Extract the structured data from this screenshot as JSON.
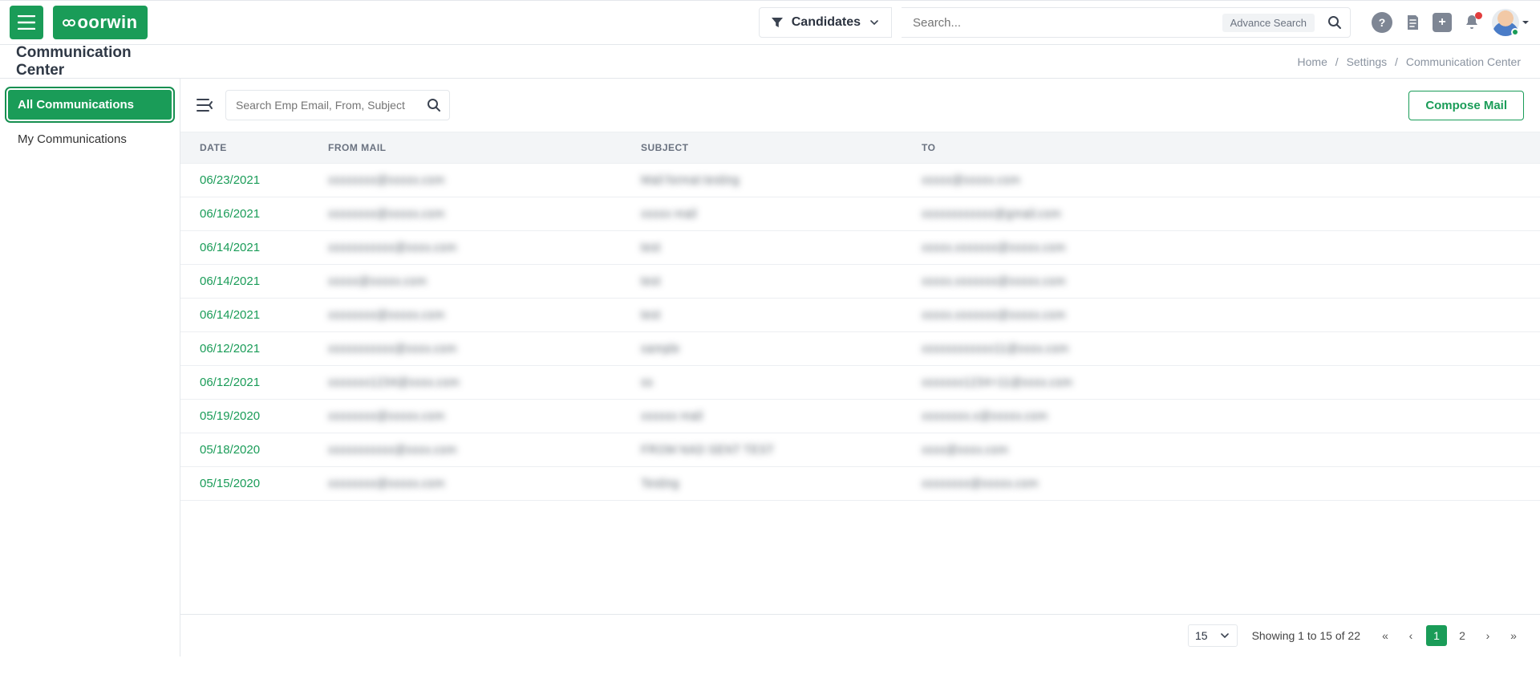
{
  "header": {
    "logo_text": "oorwin",
    "candidates_label": "Candidates",
    "search_placeholder": "Search...",
    "advance_search_label": "Advance Search"
  },
  "subheader": {
    "title": "Communication Center",
    "crumbs": {
      "home": "Home",
      "settings": "Settings",
      "current": "Communication Center"
    }
  },
  "sidebar": {
    "items": [
      "All Communications",
      "My Communications"
    ],
    "active_index": 0
  },
  "toolbar": {
    "search_placeholder": "Search Emp Email, From, Subject",
    "compose_label": "Compose Mail"
  },
  "table": {
    "columns": [
      "DATE",
      "FROM MAIL",
      "SUBJECT",
      "TO"
    ],
    "rows": [
      {
        "date": "06/23/2021",
        "from": "xxxxxxxx@xxxxx.com",
        "subject": "Mail format testing",
        "to": "xxxxx@xxxxx.com"
      },
      {
        "date": "06/16/2021",
        "from": "xxxxxxxx@xxxxx.com",
        "subject": "xxxxx mail",
        "to": "xxxxxxxxxxxx@gmail.com"
      },
      {
        "date": "06/14/2021",
        "from": "xxxxxxxxxxx@xxxx.com",
        "subject": "test",
        "to": "xxxxx.xxxxxxx@xxxxx.com"
      },
      {
        "date": "06/14/2021",
        "from": "xxxxx@xxxxx.com",
        "subject": "test",
        "to": "xxxxx.xxxxxxx@xxxxx.com"
      },
      {
        "date": "06/14/2021",
        "from": "xxxxxxxx@xxxxx.com",
        "subject": "test",
        "to": "xxxxx.xxxxxxx@xxxxx.com"
      },
      {
        "date": "06/12/2021",
        "from": "xxxxxxxxxxx@xxxx.com",
        "subject": "sample",
        "to": "xxxxxxxxxxxx11@xxxx.com"
      },
      {
        "date": "06/12/2021",
        "from": "xxxxxxx1234@xxxx.com",
        "subject": "ss",
        "to": "xxxxxxx1234+11@xxxx.com"
      },
      {
        "date": "05/19/2020",
        "from": "xxxxxxxx@xxxxx.com",
        "subject": "xxxxxx mail",
        "to": "xxxxxxxx.x@xxxxx.com"
      },
      {
        "date": "05/18/2020",
        "from": "xxxxxxxxxxx@xxxx.com",
        "subject": "FROM NAD SENT TEST",
        "to": "xxxx@xxxx.com"
      },
      {
        "date": "05/15/2020",
        "from": "xxxxxxxx@xxxxx.com",
        "subject": "Testing",
        "to": "xxxxxxxx@xxxxx.com"
      }
    ]
  },
  "footer": {
    "page_size": "15",
    "result_text": "Showing 1 to 15 of 22",
    "pages": [
      "1",
      "2"
    ],
    "active_page_index": 0
  }
}
